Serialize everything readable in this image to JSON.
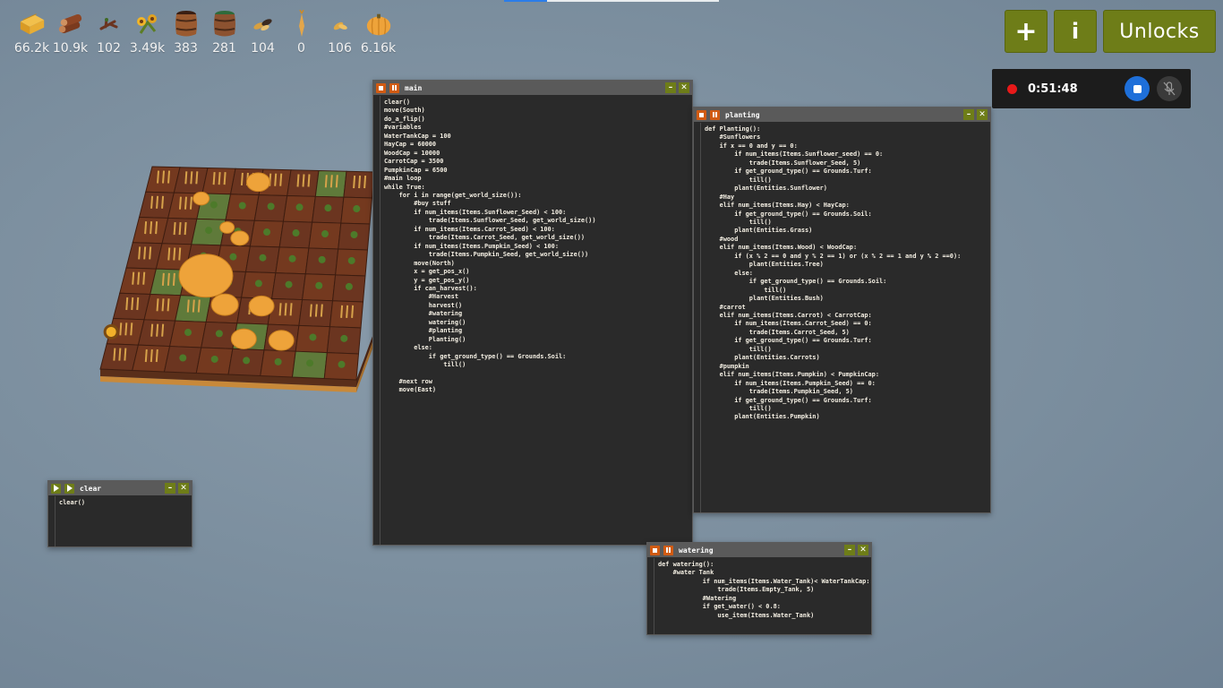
{
  "resources": [
    {
      "icon": "hay-icon",
      "value": "66.2k"
    },
    {
      "icon": "wood-log-icon",
      "value": "10.9k"
    },
    {
      "icon": "tree-branch-icon",
      "value": "102"
    },
    {
      "icon": "sunflower-bunch-icon",
      "value": "3.49k"
    },
    {
      "icon": "water-barrel-icon",
      "value": "383"
    },
    {
      "icon": "fertilizer-barrel-icon",
      "value": "281"
    },
    {
      "icon": "seed-pile-icon",
      "value": "104"
    },
    {
      "icon": "carrot-icon",
      "value": "0"
    },
    {
      "icon": "cactus-seed-icon",
      "value": "106"
    },
    {
      "icon": "pumpkin-icon",
      "value": "6.16k"
    }
  ],
  "buttons": {
    "add": "+",
    "info": "i",
    "unlocks": "Unlocks"
  },
  "recorder": {
    "time": "0:51:48"
  },
  "windows": {
    "main": {
      "title": "main",
      "code": "clear()\nmove(South)\ndo_a_flip()\n#variables\nWaterTankCap = 100\nHayCap = 60000\nWoodCap = 10000\nCarrotCap = 3500\nPumpkinCap = 6500\n#main loop\nwhile True:\n    for i in range(get_world_size()):\n        #buy stuff\n        if num_items(Items.Sunflower_Seed) < 100:\n            trade(Items.Sunflower_Seed, get_world_size())\n        if num_items(Items.Carrot_Seed) < 100:\n            trade(Items.Carrot_Seed, get_world_size())\n        if num_items(Items.Pumpkin_Seed) < 100:\n            trade(Items.Pumpkin_Seed, get_world_size())\n        move(North)\n        x = get_pos_x()\n        y = get_pos_y()\n        if can_harvest():\n            #Harvest\n            harvest()\n            #watering\n            watering()\n            #planting\n            Planting()\n        else:\n            if get_ground_type() == Grounds.Soil:\n                till()\n\n    #next row\n    move(East)"
    },
    "planting": {
      "title": "planting",
      "code": "def Planting():\n    #Sunflowers\n    if x == 0 and y == 0:\n        if num_items(Items.Sunflower_seed) == 0:\n            trade(Items.Sunflower_Seed, 5)\n        if get_ground_type() == Grounds.Turf:\n            till()\n        plant(Entities.Sunflower)\n    #Hay\n    elif num_items(Items.Hay) < HayCap:\n        if get_ground_type() == Grounds.Soil:\n            till()\n        plant(Entities.Grass)\n    #wood\n    elif num_items(Items.Wood) < WoodCap:\n        if (x % 2 == 0 and y % 2 == 1) or (x % 2 == 1 and y % 2 ==0):\n            plant(Entities.Tree)\n        else:\n            if get_ground_type() == Grounds.Soil:\n                till()\n            plant(Entities.Bush)\n    #carrot\n    elif num_items(Items.Carrot) < CarrotCap:\n        if num_items(Items.Carrot_Seed) == 0:\n            trade(Items.Carrot_Seed, 5)\n        if get_ground_type() == Grounds.Turf:\n            till()\n        plant(Entities.Carrots)\n    #pumpkin\n    elif num_items(Items.Pumpkin) < PumpkinCap:\n        if num_items(Items.Pumpkin_Seed) == 0:\n            trade(Items.Pumpkin_Seed, 5)\n        if get_ground_type() == Grounds.Turf:\n            till()\n        plant(Entities.Pumpkin)"
    },
    "clear": {
      "title": "clear",
      "code": "clear()"
    },
    "watering": {
      "title": "watering",
      "code": "def watering():\n    #water Tank\n            if num_items(Items.Water_Tank)< WaterTankCap:\n                trade(Items.Empty_Tank, 5)\n            #Watering\n            if get_water() < 0.8:\n                use_item(Items.Water_Tank)"
    }
  }
}
